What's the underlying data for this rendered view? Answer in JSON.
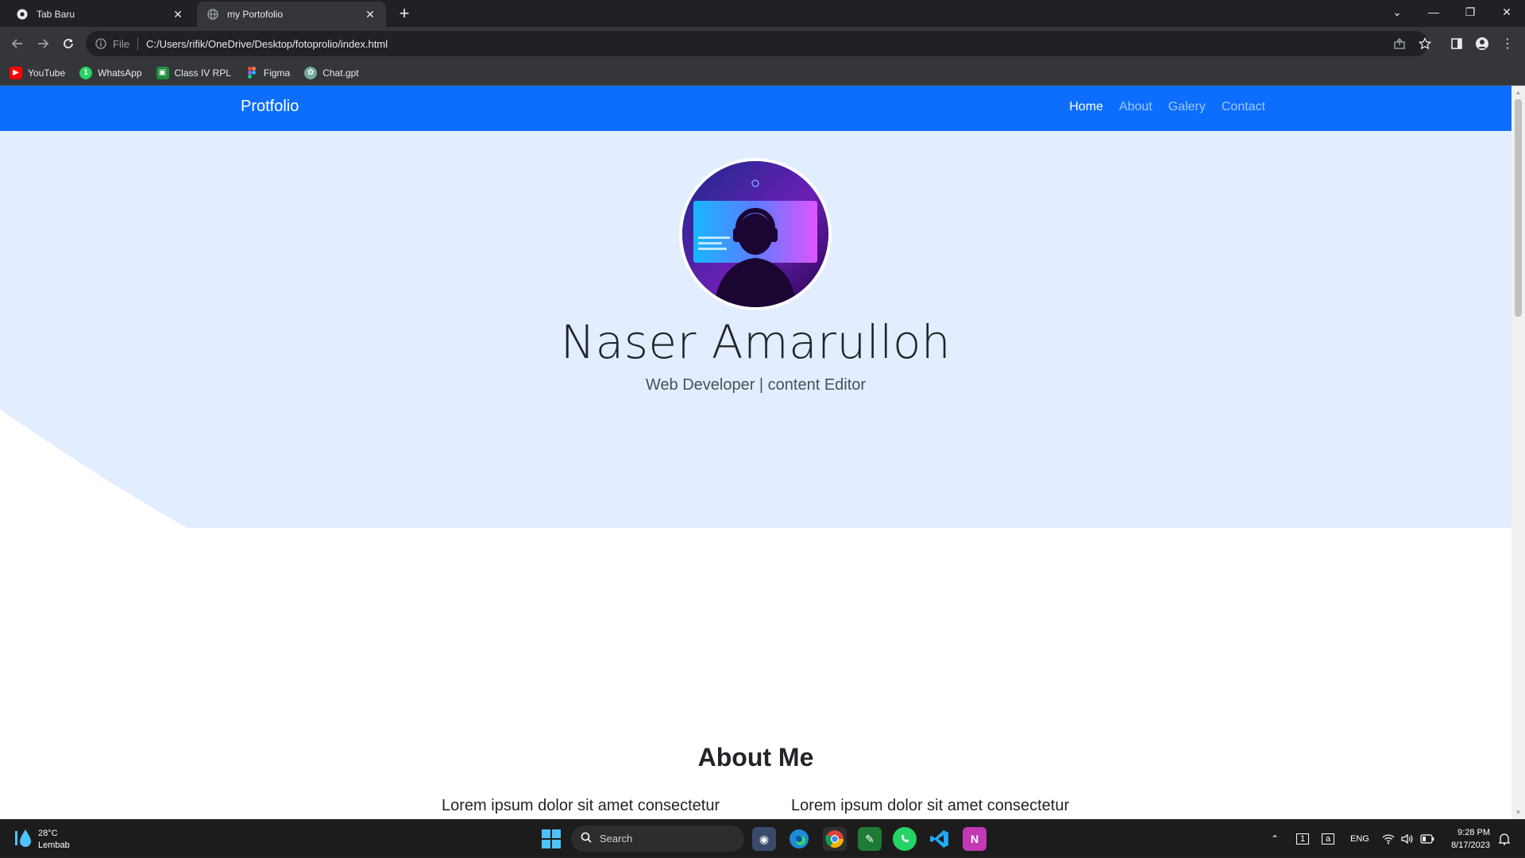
{
  "browser": {
    "tabs": [
      {
        "title": "Tab Baru",
        "active": false
      },
      {
        "title": "my Portofolio",
        "active": true
      }
    ],
    "address": {
      "scheme_label": "File",
      "url": "C:/Users/rifik/OneDrive/Desktop/fotoprolio/index.html"
    },
    "bookmarks": [
      {
        "label": "YouTube",
        "icon": "youtube-icon",
        "color": "#ff0000"
      },
      {
        "label": "WhatsApp",
        "icon": "whatsapp-icon",
        "color": "#25d366"
      },
      {
        "label": "Class IV RPL",
        "icon": "classroom-icon",
        "color": "#1e8e3e"
      },
      {
        "label": "Figma",
        "icon": "figma-icon",
        "color": "#a259ff"
      },
      {
        "label": "Chat.gpt",
        "icon": "chatgpt-icon",
        "color": "#74aa9c"
      }
    ]
  },
  "site": {
    "brand": "Protfolio",
    "nav": [
      {
        "label": "Home",
        "active": true
      },
      {
        "label": "About",
        "active": false
      },
      {
        "label": "Galery",
        "active": false
      },
      {
        "label": "Contact",
        "active": false
      }
    ],
    "hero": {
      "name": "Naser Amarulloh",
      "tagline": "Web Developer | content Editor"
    },
    "about": {
      "title": "About Me",
      "col1": "Lorem ipsum dolor sit amet consectetur",
      "col2": "Lorem ipsum dolor sit amet consectetur"
    },
    "colors": {
      "primary": "#0d6efd",
      "hero_bg": "#e2edff"
    }
  },
  "taskbar": {
    "weather": {
      "temp": "28°C",
      "condition": "Lembab"
    },
    "search_placeholder": "Search",
    "tray": {
      "language": "ENG"
    },
    "clock": {
      "time": "9:28 PM",
      "date": "8/17/2023"
    }
  }
}
